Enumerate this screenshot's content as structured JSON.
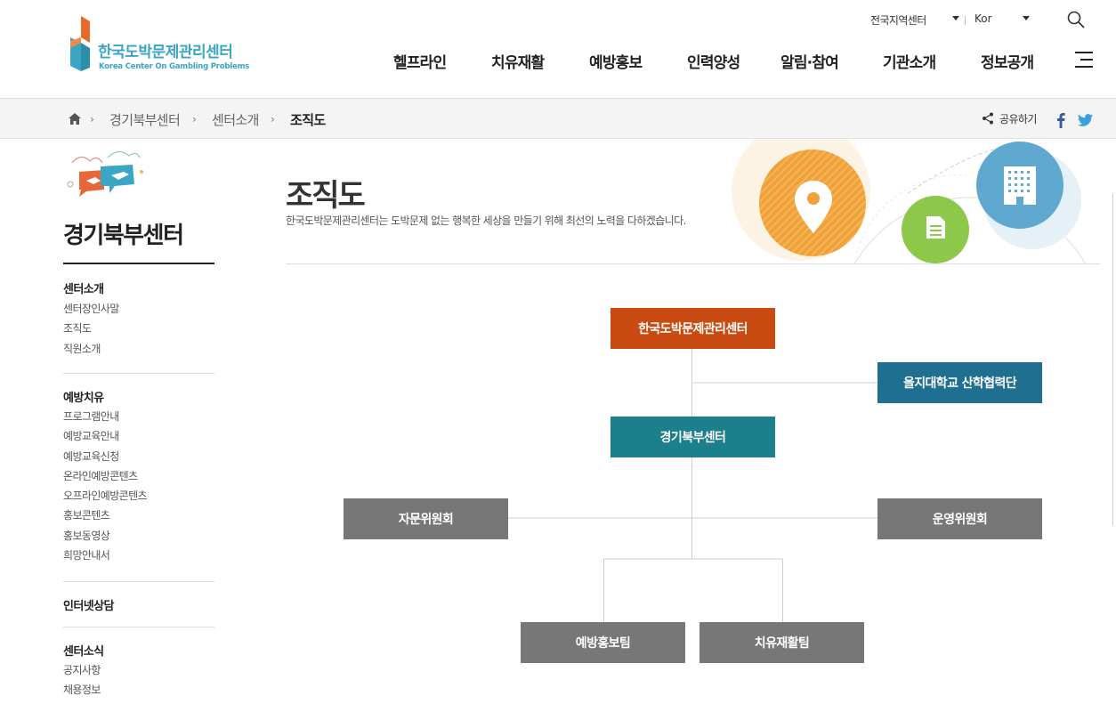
{
  "header": {
    "logo_ko": "한국도박문제관리센터",
    "logo_en": "Korea Center On Gambling Problems",
    "region_select": "전국지역센터",
    "lang_select": "Kor",
    "nav": [
      "헬프라인",
      "치유재활",
      "예방홍보",
      "인력양성",
      "알림·참여",
      "기관소개",
      "정보공개"
    ]
  },
  "breadcrumb": {
    "items": [
      "경기북부센터",
      "센터소개",
      "조직도"
    ],
    "share_label": "공유하기"
  },
  "sidebar": {
    "title": "경기북부센터",
    "groups": [
      {
        "title": "센터소개",
        "items": [
          "센터장인사말",
          "조직도",
          "직원소개"
        ]
      },
      {
        "title": "예방치유",
        "items": [
          "프로그램안내",
          "예방교육안내",
          "예방교육신청",
          "온라인예방콘텐츠",
          "오프라인예방콘텐츠",
          "홍보콘텐츠",
          "홍보동영상",
          "희망안내서"
        ]
      },
      {
        "title": "인터넷상담",
        "items": []
      },
      {
        "title": "센터소식",
        "items": [
          "공지사항",
          "채용정보"
        ]
      }
    ]
  },
  "content": {
    "title": "조직도",
    "description": "한국도박문제관리센터는 도박문제 없는 행복한 세상을 만들기 위해 최선의 노력을 다하겠습니다."
  },
  "org": {
    "head": "한국도박문제관리센터",
    "partner": "을지대학교 산학협력단",
    "center": "경기북부센터",
    "advisory": "자문위원회",
    "steering": "운영위원회",
    "team1": "예방홍보팀",
    "team2": "치유재활팀"
  },
  "colors": {
    "head": "#c94b12",
    "partner": "#1e6f90",
    "center": "#1c7f8c",
    "committee": "#777777",
    "logo_teal": "#3aa6c4"
  }
}
